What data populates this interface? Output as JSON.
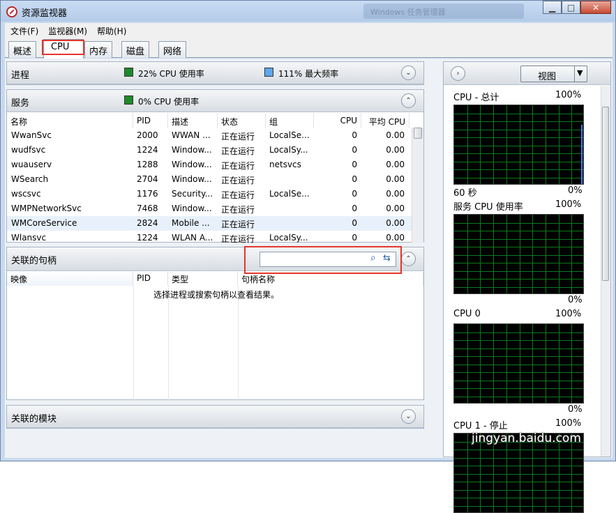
{
  "window": {
    "title": "资源监视器",
    "ghost_title": "Windows 任务管理器"
  },
  "menu": [
    "文件(F)",
    "监视器(M)",
    "帮助(H)"
  ],
  "tabs": [
    "概述",
    "CPU",
    "内存",
    "磁盘",
    "网络"
  ],
  "processes": {
    "title": "进程",
    "cpu_usage": "22% CPU 使用率",
    "max_freq": "111% 最大频率"
  },
  "services": {
    "title": "服务",
    "cpu_usage": "0% CPU 使用率",
    "columns": [
      "名称",
      "PID",
      "描述",
      "状态",
      "组",
      "CPU",
      "平均 CPU"
    ],
    "rows": [
      {
        "name": "WwanSvc",
        "pid": "2000",
        "desc": "WWAN ...",
        "status": "正在运行",
        "group": "LocalSe...",
        "cpu": "0",
        "avg": "0.00"
      },
      {
        "name": "wudfsvc",
        "pid": "1224",
        "desc": "Window...",
        "status": "正在运行",
        "group": "LocalSy...",
        "cpu": "0",
        "avg": "0.00"
      },
      {
        "name": "wuauserv",
        "pid": "1288",
        "desc": "Window...",
        "status": "正在运行",
        "group": "netsvcs",
        "cpu": "0",
        "avg": "0.00"
      },
      {
        "name": "WSearch",
        "pid": "2704",
        "desc": "Window...",
        "status": "正在运行",
        "group": "",
        "cpu": "0",
        "avg": "0.00"
      },
      {
        "name": "wscsvc",
        "pid": "1176",
        "desc": "Security...",
        "status": "正在运行",
        "group": "LocalSe...",
        "cpu": "0",
        "avg": "0.00"
      },
      {
        "name": "WMPNetworkSvc",
        "pid": "7468",
        "desc": "Window...",
        "status": "正在运行",
        "group": "",
        "cpu": "0",
        "avg": "0.00"
      },
      {
        "name": "WMCoreService",
        "pid": "2824",
        "desc": "Mobile ...",
        "status": "正在运行",
        "group": "",
        "cpu": "0",
        "avg": "0.00"
      },
      {
        "name": "Wlansvc",
        "pid": "1224",
        "desc": "WLAN A...",
        "status": "正在运行",
        "group": "LocalSy...",
        "cpu": "0",
        "avg": "0.00"
      }
    ]
  },
  "handles": {
    "title": "关联的句柄",
    "search_placeholder": "",
    "columns": [
      "映像",
      "PID",
      "类型",
      "句柄名称"
    ],
    "empty_text": "选择进程或搜索句柄以查看结果。"
  },
  "modules": {
    "title": "关联的模块"
  },
  "right_panel": {
    "view_label": "视图",
    "graphs": [
      {
        "title": "CPU - 总计",
        "max": "100%",
        "footer_left": "60 秒",
        "footer_right": "0%"
      },
      {
        "title": "服务 CPU 使用率",
        "max": "100%",
        "footer_left": "",
        "footer_right": "0%"
      },
      {
        "title": "CPU 0",
        "max": "100%",
        "footer_left": "",
        "footer_right": "0%"
      },
      {
        "title": "CPU 1 - 停止",
        "max": "100%",
        "footer_left": "",
        "footer_right": ""
      }
    ]
  },
  "watermark": "jingyan.baidu.com",
  "colors": {
    "highlight_box": "#e5352b",
    "graph_grid": "#0b7a1c",
    "cpu_swatch": "#1d8a2a",
    "freq_swatch": "#5ea7ec"
  }
}
